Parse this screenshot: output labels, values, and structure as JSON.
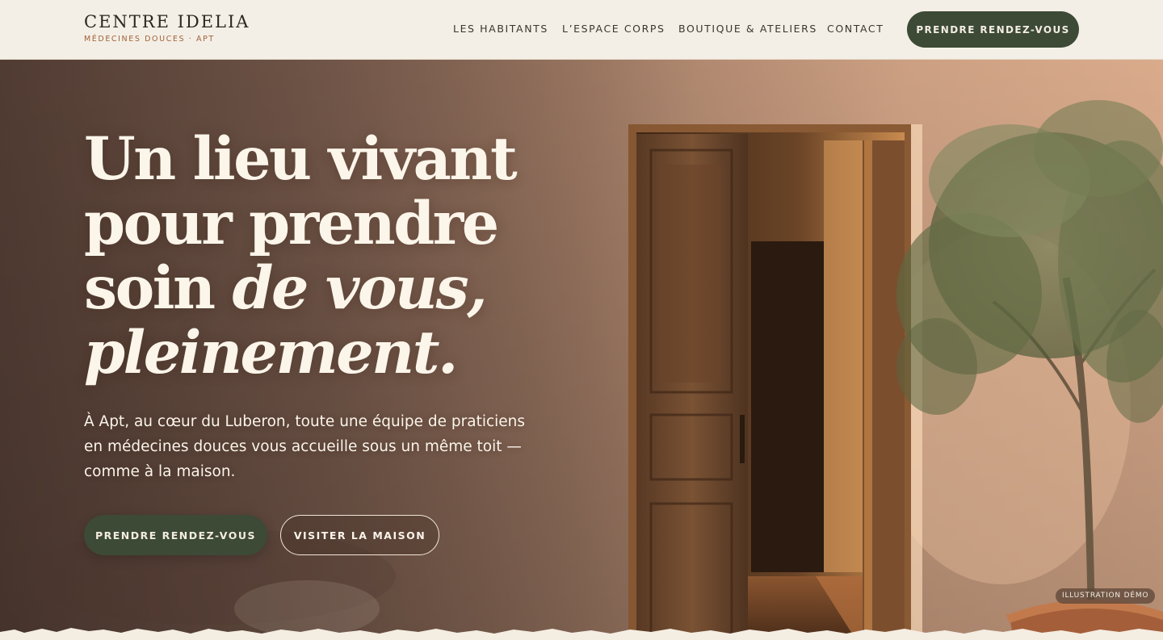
{
  "brand": {
    "name": "CENTRE IDELIA",
    "tagline": "MÉDECINES DOUCES · APT"
  },
  "nav": {
    "items": [
      {
        "label": "LES HABITANTS"
      },
      {
        "label": "L’ESPACE CORPS"
      },
      {
        "label": "BOUTIQUE & ATELIERS"
      },
      {
        "label": "CONTACT"
      }
    ],
    "cta_label": "PRENDRE RENDEZ-VOUS"
  },
  "hero": {
    "title_line1": "Un lieu vivant",
    "title_line2": "pour prendre",
    "title_line3_plain": "soin ",
    "title_line3_italic": "de vous,",
    "title_line4_italic": "pleinement.",
    "lead": "À Apt, au cœur du Luberon, toute une équipe de praticiens en médecines douces vous accueille sous un même toit — comme à la maison.",
    "primary_cta": "PRENDRE RENDEZ-VOUS",
    "secondary_cta": "VISITER LA MAISON",
    "badge": "ILLUSTRATION DÉMO"
  },
  "colors": {
    "accent_green": "#3c4a36",
    "header_bg": "#f4efe6",
    "tagline_terracotta": "#a0623a",
    "hero_text": "#fbf5ea"
  },
  "icons": {
    "hero_image": "open-wooden-door-olive-tree-photo"
  }
}
